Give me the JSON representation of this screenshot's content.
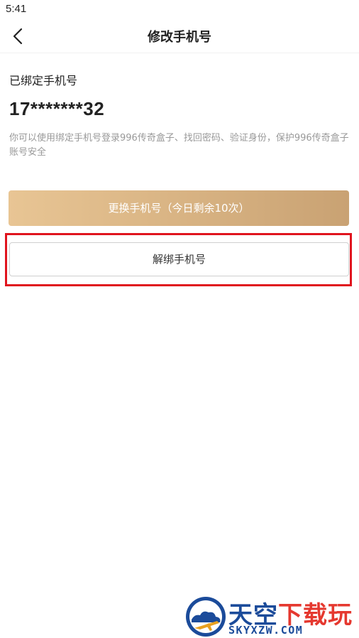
{
  "status_bar": {
    "time": "5:41"
  },
  "nav": {
    "title": "修改手机号",
    "back_icon": "chevron-left-icon"
  },
  "phone": {
    "label": "已绑定手机号",
    "masked_number": "17*******32",
    "description": "你可以使用绑定手机号登录996传奇盒子、找回密码、验证身份，保护996传奇盒子账号安全"
  },
  "buttons": {
    "change_label": "更换手机号（今日剩余10次）",
    "unbind_label": "解绑手机号"
  },
  "watermark": {
    "cn_main": "天空",
    "cn_accent": "下载玩",
    "en": "SKYXZW.COM"
  },
  "colors": {
    "gold_gradient_start": "#e8c594",
    "gold_gradient_end": "#c9a273",
    "highlight": "#e0141e",
    "watermark_blue": "#1b4b9a",
    "watermark_red": "#e5382f"
  }
}
